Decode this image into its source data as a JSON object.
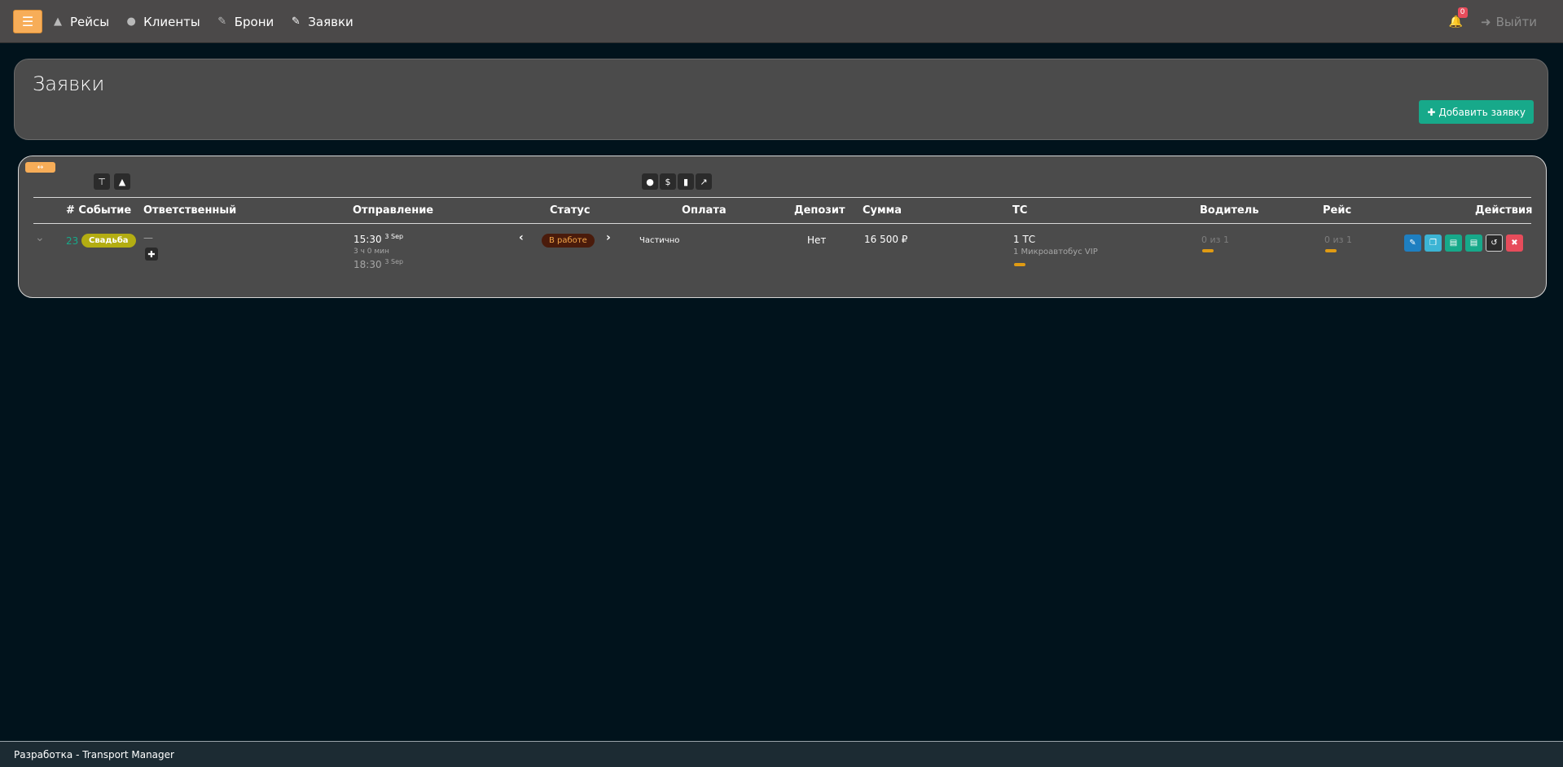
{
  "navbar": {
    "menu_icon": "hamburger-icon",
    "items": [
      {
        "label": "Рейсы",
        "icon": "road-icon"
      },
      {
        "label": "Клиенты",
        "icon": "users-icon"
      },
      {
        "label": "Брони",
        "icon": "edit-icon"
      },
      {
        "label": "Заявки",
        "icon": "edit-icon"
      }
    ],
    "notifications_count": "0",
    "logout_label": "Выйти"
  },
  "page": {
    "title": "Заявки",
    "add_button_label": "Добавить заявку"
  },
  "toolbar": {
    "collapse_icon": "arrows-horizontal-icon",
    "left_icons": [
      "signpost-icon",
      "road-icon"
    ],
    "center_icons": [
      "comment-icon",
      "dollar-icon",
      "truck-icon",
      "chart-icon"
    ]
  },
  "table": {
    "headers": {
      "event": "# Событие",
      "responsible": "Ответственный",
      "departure": "Отправление",
      "status": "Статус",
      "payment": "Оплата",
      "deposit": "Депозит",
      "sum": "Сумма",
      "vehicle": "ТС",
      "driver": "Водитель",
      "trip": "Рейс",
      "actions": "Действия"
    },
    "rows": [
      {
        "id": "23",
        "event": "Свадьба",
        "responsible": "—",
        "departure_time": "15:30",
        "departure_date": "3 Sep",
        "duration": "3 ч 0 мин",
        "arrival_time": "18:30",
        "arrival_date": "3 Sep",
        "status": "В работе",
        "payment": "Частично",
        "deposit": "Нет",
        "sum": "16 500 ₽",
        "vehicle_count": "1 ТС",
        "vehicle_detail": "1 Микроавтобус VIP",
        "driver": "0 из 1",
        "trip": "0 из 1"
      }
    ]
  },
  "colors": {
    "accent_orange": "#f7ad58",
    "success_green": "#17a98a",
    "event_badge": "#b3ad12",
    "status_badge_bg": "#4a1b0b",
    "status_badge_text": "#f3a64a",
    "progress_bar": "#e09b13"
  },
  "footer": {
    "text": "Разработка - Transport Manager"
  }
}
